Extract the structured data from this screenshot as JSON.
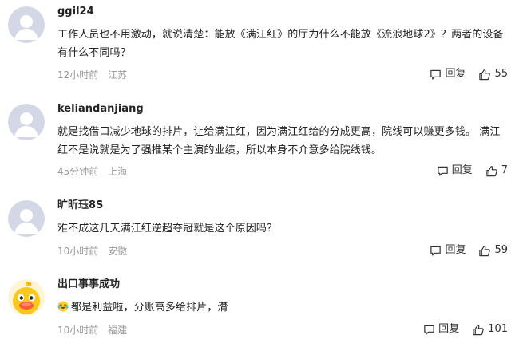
{
  "comments": [
    {
      "username": "ggil24",
      "text": "工作人员也不用激动，就说清楚：能放《满江红》的厅为什么不能放《流浪地球2》？两者的设备有什么不同吗？",
      "time": "12小时前",
      "location": "江苏",
      "reply_label": "回复",
      "likes": "55",
      "avatar_icon": "default-avatar-icon"
    },
    {
      "username": "keliandanjiang",
      "text": "就是找借口减少地球的排片，让给满江红，因为满江红给的分成更高，院线可以赚更多钱。 满江红不是说就是为了强推某个主演的业绩，所以本身不介意多给院线钱。",
      "time": "45分钟前",
      "location": "上海",
      "reply_label": "回复",
      "likes": "7",
      "avatar_icon": "default-avatar-icon"
    },
    {
      "username": "旷昕珏8S",
      "text": "难不成这几天满江红逆超夺冠就是这个原因吗？",
      "time": "10小时前",
      "location": "安徽",
      "reply_label": "回复",
      "likes": "59",
      "avatar_icon": "default-avatar-icon"
    },
    {
      "username": "出口事事成功",
      "text": "都是利益啦，分账高多给排片，潸",
      "time": "10小时前",
      "location": "福建",
      "reply_label": "回复",
      "likes": "101",
      "avatar_icon": "duck-avatar-icon",
      "text_emoji": "crying-laughing-emoji-icon"
    }
  ],
  "colors": {
    "meta_text": "#999999",
    "avatar_bg": "#d4d8e6",
    "duck_yellow": "#f8c81c"
  }
}
